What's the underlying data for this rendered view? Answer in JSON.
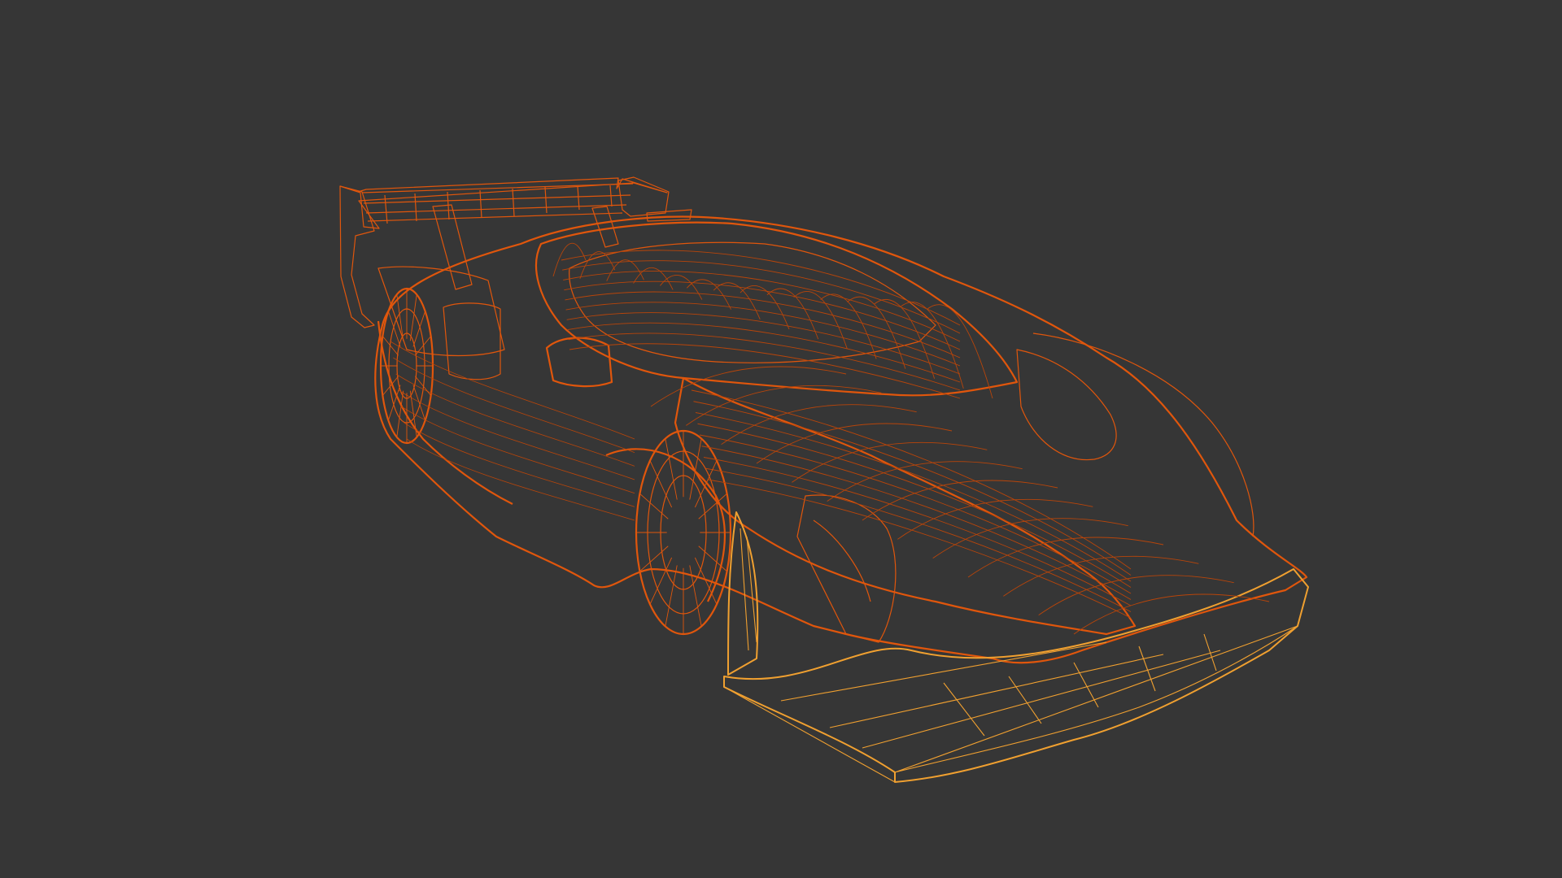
{
  "scene": {
    "background_color": "#363636",
    "subject": "wireframe-hypercar",
    "colors": {
      "body_wire": "#e0560c",
      "body_wire_dark": "#b8450a",
      "splitter_wire": "#f0a030",
      "splitter_wire_light": "#f6bb55"
    }
  }
}
